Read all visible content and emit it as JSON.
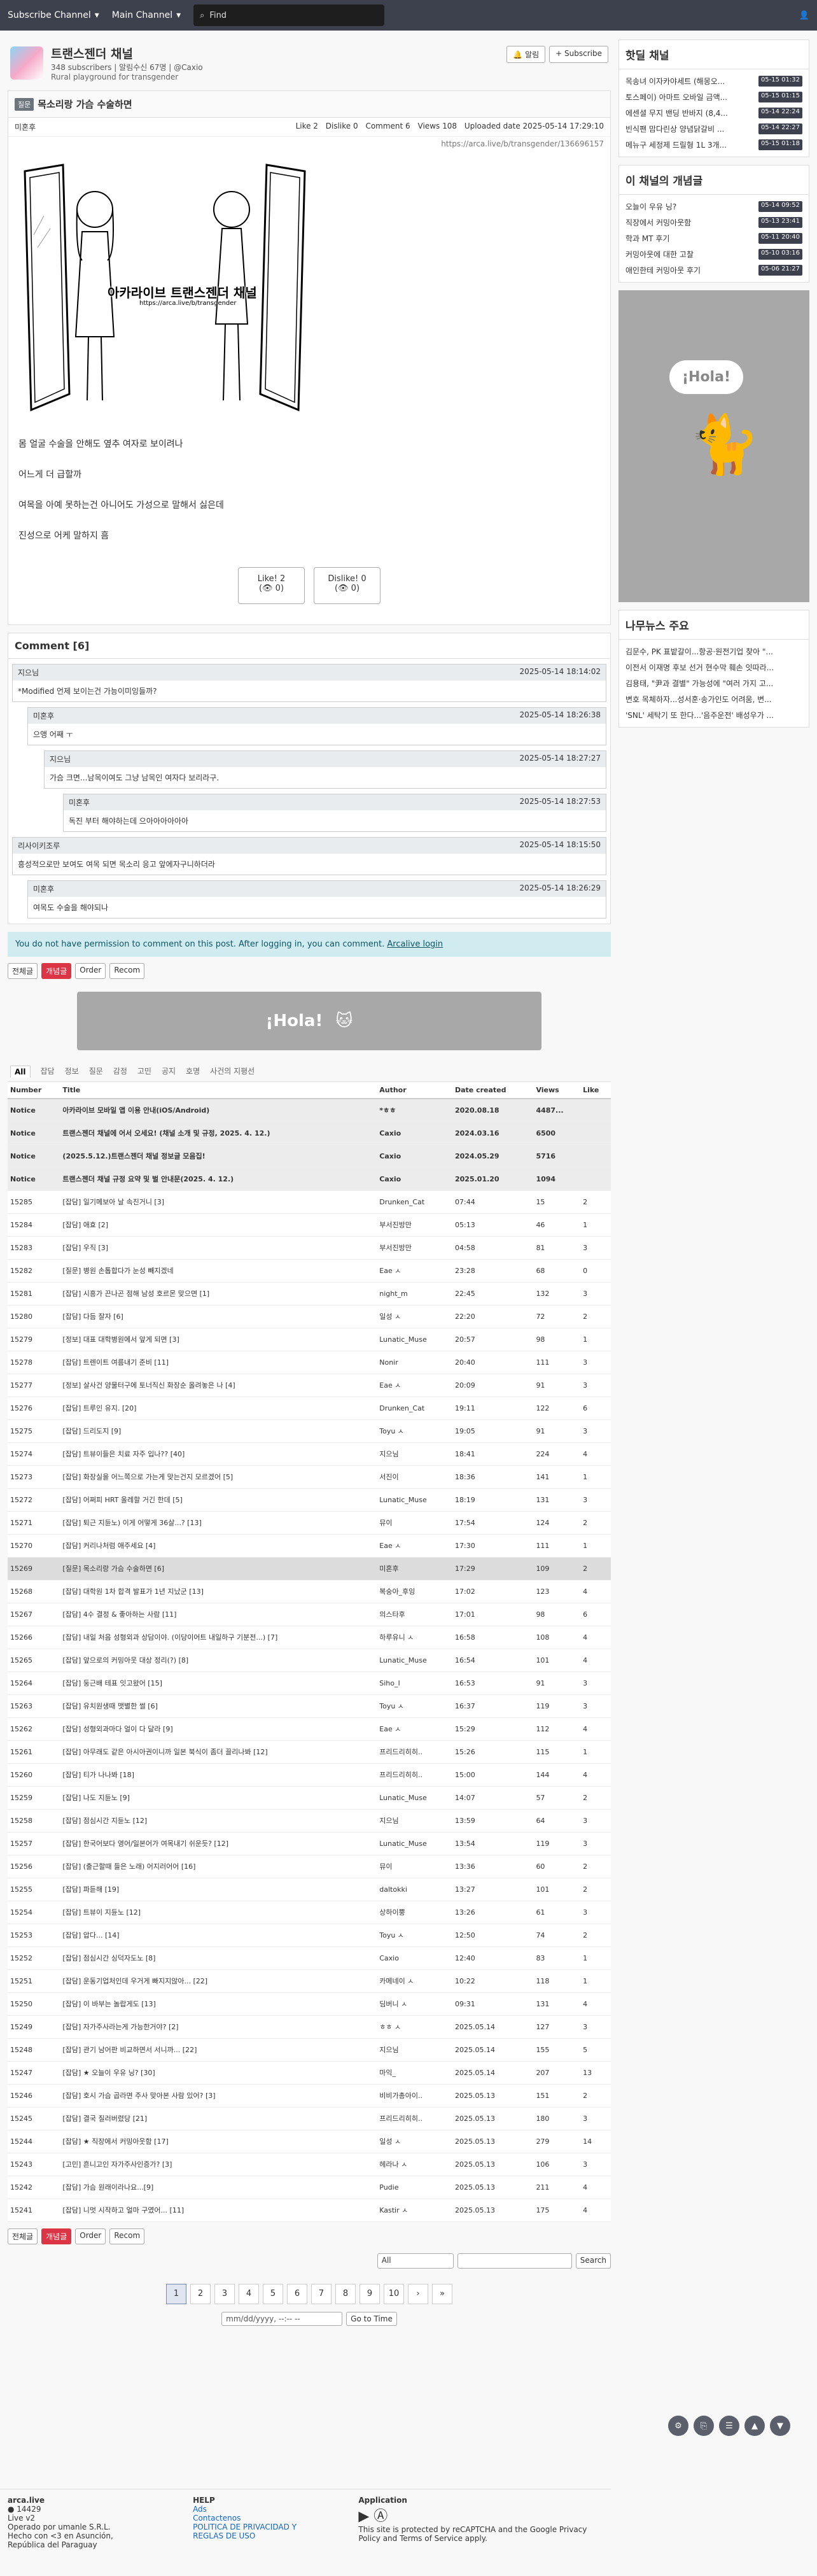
{
  "topbar": {
    "nav1": "Subscribe Channel",
    "nav2": "Main Channel",
    "search_placeholder": "Find"
  },
  "channel": {
    "title": "트랜스젠더 채널",
    "sub": "348 subscribers | 알림수신 67명 | @Caxio",
    "desc": "Rural playground for transgender",
    "alarm": "알림",
    "subscribe": "+ Subscribe"
  },
  "post": {
    "category": "질문",
    "title": "목소리랑 가슴 수술하면",
    "author": "미혼후",
    "stats": {
      "like": "Like 2",
      "dislike": "Dislike 0",
      "comment": "Comment 6",
      "views": "Views 108",
      "uploaded": "Uploaded date 2025-05-14 17:29:10"
    },
    "url": "https://arca.live/b/transgender/136696157",
    "watermark": "아카라이브 트랜스젠더 채널",
    "watermark_url": "https://arca.live/b/transgender",
    "paragraphs": [
      "몸 얼굴 수술을 안해도 옆추 여자로 보이려나",
      "어느게 더 급할까",
      "여목을 아예 못하는건 아니어도 가성으로 말해서 싫은데",
      "진성으로 어케 말하지 흠"
    ],
    "like": "Like! 2",
    "dislike": "Dislike! 0",
    "like_sub": "(👁 0)",
    "dislike_sub": "(👁 0)"
  },
  "comments": {
    "header": "Comment [6]",
    "items": [
      {
        "author": "지으님",
        "date": "2025-05-14 18:14:02",
        "text": "*Modified 언제 보이는건 가능이미잉들까?"
      },
      {
        "author": "미혼후",
        "date": "2025-05-14 18:26:38",
        "text": "으앵 어째 ㅜ"
      },
      {
        "author": "지으님",
        "date": "2025-05-14 18:27:27",
        "text": "가슴 크면...남목이여도 그냥 남목인 여자다 보리라구."
      },
      {
        "author": "미혼후",
        "date": "2025-05-14 18:27:53",
        "text": "독진 부터 해야하는데 으아아아아아아"
      },
      {
        "author": "리사이키조루",
        "date": "2025-05-14 18:15:50",
        "text": "흥성적으로만 보여도 여목 되면 목소리 응고 앞에자구니하더라"
      },
      {
        "author": "미혼후",
        "date": "2025-05-14 18:26:29",
        "text": "여목도 수술을 해야되나"
      }
    ]
  },
  "notice": {
    "text": "You do not have permission to comment on this post. After logging in, you can comment.",
    "link": "Arcalive login"
  },
  "toolbar": {
    "all": "전체글",
    "hot": "개념글",
    "order": "Order",
    "recom": "Recom"
  },
  "tabs": [
    "All",
    "잡담",
    "정보",
    "질문",
    "감정",
    "고민",
    "공지",
    "호명",
    "사건의 지평선"
  ],
  "table_headers": [
    "Number",
    "Title",
    "Author",
    "Date created",
    "Views",
    "Like"
  ],
  "rows": [
    [
      "Notice",
      "아카라이브 모바일 앱 이용 안내(iOS/Android)",
      "*ㅎㅎ",
      "2020.08.18",
      "4487...",
      ""
    ],
    [
      "Notice",
      "트랜스젠더 채널에 어서 오세요! (채널 소개 및 규정, 2025. 4. 12.)",
      "Caxio",
      "2024.03.16",
      "6500",
      ""
    ],
    [
      "Notice",
      "(2025.5.12.)트랜스젠더 채널 정보글 모음집!",
      "Caxio",
      "2024.05.29",
      "5716",
      ""
    ],
    [
      "Notice",
      "트랜스젠더 채널 규정 요약 및 벌 안내문(2025. 4. 12.)",
      "Caxio",
      "2025.01.20",
      "1094",
      ""
    ],
    [
      "15285",
      "[잡담] 일기메보아 날 속진거니 [3]",
      "Drunken_Cat",
      "07:44",
      "15",
      "2"
    ],
    [
      "15284",
      "[잡담] 애효 [2]",
      "부서진방만",
      "05:13",
      "46",
      "1"
    ],
    [
      "15283",
      "[잡담] 우직 [3]",
      "부서진방만",
      "04:58",
      "81",
      "3"
    ],
    [
      "15282",
      "[질문] 병원 손톱합다가 눈성 빼지겠네",
      "Eae ㅅ",
      "23:28",
      "68",
      "0"
    ],
    [
      "15281",
      "[잡담] 시흥가 끈나곤 점해 남성 호르몬 맞으면 [1]",
      "night_m",
      "22:45",
      "132",
      "3"
    ],
    [
      "15280",
      "[잡담] 다듬 잘자 [6]",
      "일성 ㅅ",
      "22:20",
      "72",
      "2"
    ],
    [
      "15279",
      "[정보] 대표 대학병원에서 앞게 되면 [3]",
      "Lunatic_Muse",
      "20:57",
      "98",
      "1"
    ],
    [
      "15278",
      "[잡담] 트렌이트 여름내기 준비 [11]",
      "Nonir",
      "20:40",
      "111",
      "3"
    ],
    [
      "15277",
      "[정보] 살사건 양물터구에 토너직신 화장순 올려놓은 나 [4]",
      "Eae ㅅ",
      "20:09",
      "91",
      "3"
    ],
    [
      "15276",
      "[잡담] 트루인 유지. [20]",
      "Drunken_Cat",
      "19:11",
      "122",
      "6"
    ],
    [
      "15275",
      "[잡담] 드리도지 [9]",
      "Toyu ㅅ",
      "19:05",
      "91",
      "3"
    ],
    [
      "15274",
      "[잡담] 트뷰이들은 치료 자주 입나?? [40]",
      "지으님",
      "18:41",
      "224",
      "4"
    ],
    [
      "15273",
      "[잡담] 화장실을 어느쪽으로 가는게 맞는건지 모르겠어 [5]",
      "서진이",
      "18:36",
      "141",
      "1"
    ],
    [
      "15272",
      "[잡담] 어쩌피 HRT 올레할 거긴 한데 [5]",
      "Lunatic_Muse",
      "18:19",
      "131",
      "3"
    ],
    [
      "15271",
      "[잡담] 퇴근 지듄노) 이게 어떻게 36살...? [13]",
      "뮤이",
      "17:54",
      "124",
      "2"
    ],
    [
      "15270",
      "[잡담] 커리나처럼 애주세요 [4]",
      "Eae ㅅ",
      "17:30",
      "111",
      "1"
    ],
    [
      "15269",
      "[질문] 목소리랑 가슴 수술하면 [6]",
      "미혼후",
      "17:29",
      "109",
      "2"
    ],
    [
      "15268",
      "[잡담] 대학원 1차 합격 발표가 1년 지났군 [13]",
      "복숭아_후잉",
      "17:02",
      "123",
      "4"
    ],
    [
      "15267",
      "[잡담] 4수 결정 & 좋아하는 사람 [11]",
      "의스타후",
      "17:01",
      "98",
      "6"
    ],
    [
      "15266",
      "[잡담] 내일 처음 성형외과 상담이야. (이당이어트 내일하구 기분전...) [7]",
      "하루유니 ㅅ",
      "16:58",
      "108",
      "4"
    ],
    [
      "15265",
      "[잡담] 앞으로의 커밍아웃 대상 정리(?) [8]",
      "Lunatic_Muse",
      "16:54",
      "101",
      "4"
    ],
    [
      "15264",
      "[잡담] 둥근배 테표 잇고왔어 [15]",
      "Siho_I",
      "16:53",
      "91",
      "3"
    ],
    [
      "15263",
      "[잡담] 유치원생때 맷별한 썰 [6]",
      "Toyu ㅅ",
      "16:37",
      "119",
      "3"
    ],
    [
      "15262",
      "[잡담] 성형외과마다 얼이 다 달라 [9]",
      "Eae ㅅ",
      "15:29",
      "112",
      "4"
    ],
    [
      "15261",
      "[잡담] 아무래도 같은 아시아권이니까 일본 북식이 좀더 끌리나봐 [12]",
      "프리드리히히..",
      "15:26",
      "115",
      "1"
    ],
    [
      "15260",
      "[잡담] 티가 나나봐 [18]",
      "프리드리히히..",
      "15:00",
      "144",
      "4"
    ],
    [
      "15259",
      "[잡담] 나도 지듄노 [9]",
      "Lunatic_Muse",
      "14:07",
      "57",
      "2"
    ],
    [
      "15258",
      "[잡담] 점심시간 지듄노 [12]",
      "지으님",
      "13:59",
      "64",
      "3"
    ],
    [
      "15257",
      "[잡담] 한국어보다 영어/일본어가 여목내기 쉬운듯? [12]",
      "Lunatic_Muse",
      "13:54",
      "119",
      "3"
    ],
    [
      "15256",
      "[잡담] (출근할때 들은 노래) 어지러어어 [16]",
      "뮤이",
      "13:36",
      "60",
      "2"
    ],
    [
      "15255",
      "[잡담] 파듣해 [19]",
      "daltokki",
      "13:27",
      "101",
      "2"
    ],
    [
      "15254",
      "[잡담] 트뷰이 지듄노 [12]",
      "상하이뿡",
      "13:26",
      "61",
      "3"
    ],
    [
      "15253",
      "[잡담] 압다... [14]",
      "Toyu ㅅ",
      "12:50",
      "74",
      "2"
    ],
    [
      "15252",
      "[잡담] 점심시간 싱덕자도노 [8]",
      "Caxio",
      "12:40",
      "83",
      "1"
    ],
    [
      "15251",
      "[잡담] 운동기업처인데 우거게 빠지지않아... [22]",
      "카메네이 ㅅ",
      "10:22",
      "118",
      "1"
    ],
    [
      "15250",
      "[잡담] 이 바부는 놀랍게도 [13]",
      "딤버니 ㅅ",
      "09:31",
      "131",
      "4"
    ],
    [
      "15249",
      "[잡담] 자가주사라는게 가능한거야? [2]",
      "ㅎㅎ ㅅ",
      "2025.05.14",
      "127",
      "3"
    ],
    [
      "15248",
      "[잡담] 관기 남어판 비교하면서 서니까... [22]",
      "지으님",
      "2025.05.14",
      "155",
      "5"
    ],
    [
      "15247",
      "[잡담] ★ 오늘이 우유 닝? [30]",
      "마익_",
      "2025.05.14",
      "207",
      "13"
    ],
    [
      "15246",
      "[잡담] 호시 가슴 곱라면 주사 맞아본 사람 있어? [3]",
      "비비가총아이..",
      "2025.05.13",
      "151",
      "2"
    ],
    [
      "15245",
      "[잡담] 결국 질러버렸당 [21]",
      "프리드리히히..",
      "2025.05.13",
      "180",
      "3"
    ],
    [
      "15244",
      "[잡담] ★ 직장에서 커밍아웃함 [17]",
      "일성 ㅅ",
      "2025.05.13",
      "279",
      "14"
    ],
    [
      "15243",
      "[고민] 흔니고인 자가주사인증가? [3]",
      "헤라나 ㅅ",
      "2025.05.13",
      "106",
      "3"
    ],
    [
      "15242",
      "[잡담] 가슴 원래이라나요...[9]",
      "Pudie",
      "2025.05.13",
      "211",
      "4"
    ],
    [
      "15241",
      "[잡담] 니멋 시작하고 얼마 구였어... [11]",
      "Kastir ㅅ",
      "2025.05.13",
      "175",
      "4"
    ]
  ],
  "pager": [
    "1",
    "2",
    "3",
    "4",
    "5",
    "6",
    "7",
    "8",
    "9",
    "10"
  ],
  "search": {
    "select": "All",
    "btn": "Search",
    "date_placeholder": "mm/dd/yyyy, --:-- --",
    "goto": "Go to Time"
  },
  "side": {
    "hot_title": "핫딜 채널",
    "hot": [
      [
        "목송녀 이자카야세트 (해몽오...",
        "05-15 01:32"
      ],
      [
        "토스페이) 아마트 오바일 금액...",
        "05-15 01:15"
      ],
      [
        "에센셜 무지 밴딩 반바지 (8,4...",
        "05-14 22:24"
      ],
      [
        "빈식팬 맘다린상 양념닭갈비 ...",
        "05-14 22:27"
      ],
      [
        "메뉴구 세정제 드릴형 1L 3개...",
        "05-15 01:18"
      ]
    ],
    "best_title": "이 채널의 개념글",
    "best": [
      [
        "오늘이 우유 닝?",
        "05-14 09:52"
      ],
      [
        "직장에서 커밍아웃함",
        "05-13 23:41"
      ],
      [
        "학과 MT 후기",
        "05-11 20:40"
      ],
      [
        "커밍아웃에 대한 고찰",
        "05-10 03:16"
      ],
      [
        "애인한테 커밍아웃 후기",
        "05-06 21:27"
      ]
    ],
    "hola": "¡Hola!",
    "news_title": "나무뉴스 주요",
    "news": [
      "김문수, PK 표밭갈이...항공·원전기업 찾아 \"...",
      "이전서 이재명 후보 선거 현수막 훼손 잇따라...",
      "김용태, \"尹과 결별\" 가능성에 \"여러 가지 고...",
      "변호 목체하자...성서훈·송가인도 어려움, 변...",
      "'SNL' 세탁기 또 한다...'음주운전' 배성우가 ..."
    ]
  },
  "footer": {
    "site": "arca.live",
    "users": "● 14429",
    "ver": "Live v2",
    "corp": "Operado por umanle S.R.L.",
    "made": "Hecho con <3 en Asunción, República del Paraguay",
    "help": "HELP",
    "ads": "Ads",
    "contact": "Contactenos",
    "policy": "POLITICA DE PRIVACIDAD Y REGLAS DE USO",
    "app": "Application",
    "recaptcha": "This site is protected by reCAPTCHA and the Google Privacy Policy and Terms of Service apply."
  }
}
